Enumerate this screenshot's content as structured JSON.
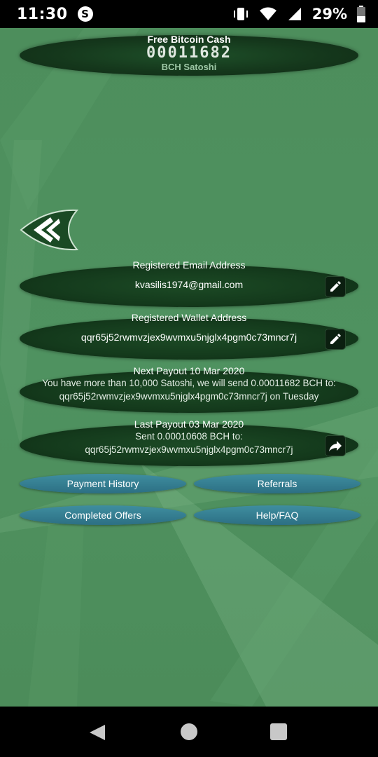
{
  "status_bar": {
    "time": "11:30",
    "app_icon_letter": "S",
    "battery_percent": "29%"
  },
  "header": {
    "title": "Free Bitcoin Cash",
    "counter": "00011682",
    "unit": "BCH Satoshi"
  },
  "panels": {
    "email": {
      "title": "Registered Email Address",
      "value": "kvasilis1974@gmail.com"
    },
    "wallet": {
      "title": "Registered Wallet Address",
      "value": "qqr65j52rwmvzjex9wvmxu5njglx4pgm0c73mncr7j"
    },
    "next_payout": {
      "title": "Next Payout 10 Mar 2020",
      "line1": "You have more than 10,000 Satoshi, we will send 0.00011682 BCH to:",
      "line2": "qqr65j52rwmvzjex9wvmxu5njglx4pgm0c73mncr7j on Tuesday"
    },
    "last_payout": {
      "title": "Last Payout 03 Mar 2020",
      "line1": "Sent 0.00010608 BCH to:",
      "line2": "qqr65j52rwmvzjex9wvmxu5njglx4pgm0c73mncr7j"
    }
  },
  "buttons": {
    "payment_history": "Payment History",
    "referrals": "Referrals",
    "completed_offers": "Completed Offers",
    "help_faq": "Help/FAQ"
  },
  "icons": {
    "back": "back-chevron-icon",
    "edit": "pencil-icon",
    "share": "share-arrow-icon"
  },
  "colors": {
    "background": "#4f8f5e",
    "panel": "#143a1c",
    "pill": "#2c6f84"
  }
}
